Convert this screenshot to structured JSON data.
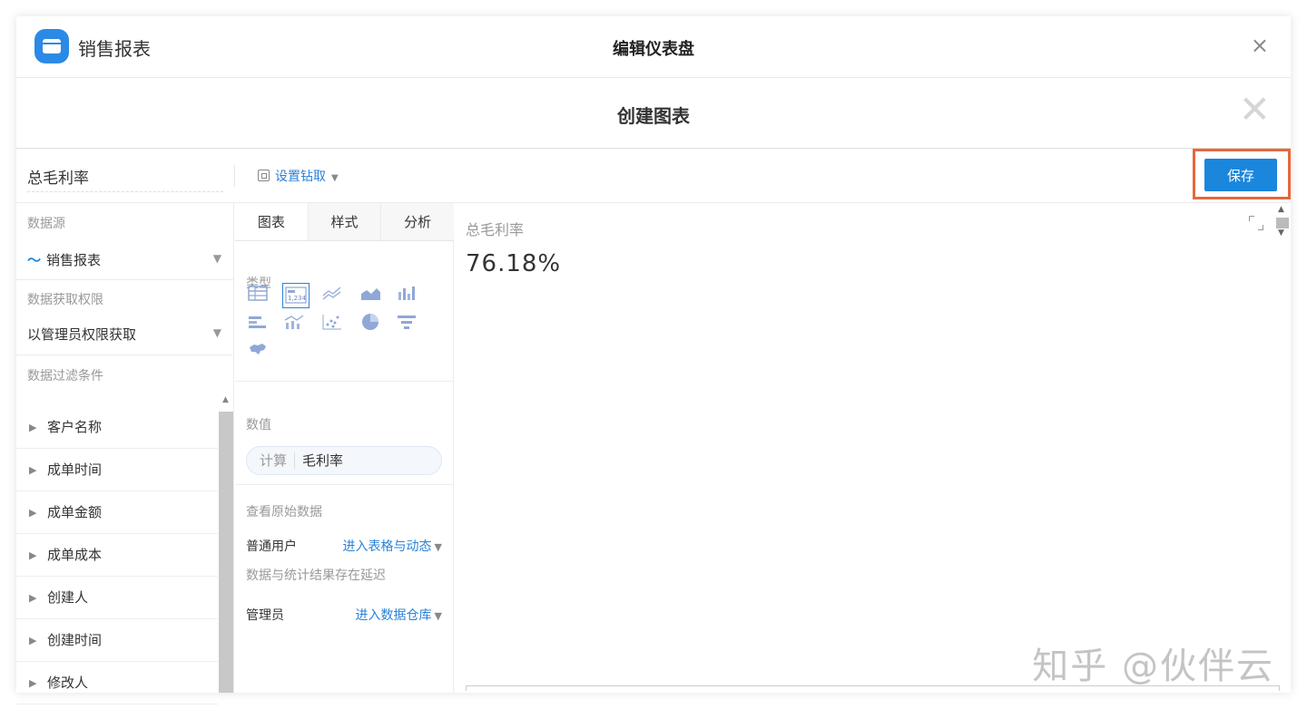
{
  "app": {
    "name": "销售报表",
    "title": "编辑仪表盘",
    "close": "×"
  },
  "dialog": {
    "title": "创建图表",
    "close": "✕"
  },
  "toolbar": {
    "chart_name": "总毛利率",
    "drill_label": "设置钻取",
    "drill_caret": "▼",
    "save_label": "保存"
  },
  "left": {
    "datasource_label": "数据源",
    "datasource_value": "销售报表",
    "datasource_icon": "trend-icon",
    "permission_label": "数据获取权限",
    "permission_value": "以管理员权限获取",
    "filter_label": "数据过滤条件",
    "caret": "▼",
    "filters": [
      "客户名称",
      "成单时间",
      "成单金额",
      "成单成本",
      "创建人",
      "创建时间",
      "修改人"
    ]
  },
  "tabs": [
    "图表",
    "样式",
    "分析"
  ],
  "chart_config": {
    "type_label": "类型",
    "types": [
      "table-icon",
      "kpi-number-icon",
      "line-chart-icon",
      "area-chart-icon",
      "bar-chart-icon",
      "horizontal-bar-icon",
      "combo-chart-icon",
      "scatter-chart-icon",
      "pie-chart-icon",
      "funnel-chart-icon",
      "map-icon"
    ],
    "selected_type": "kpi-number-icon",
    "value_label": "数值",
    "calc_tag": "计算",
    "calc_field": "毛利率",
    "raw_label": "查看原始数据",
    "normal_user_label": "普通用户",
    "normal_user_link": "进入表格与动态",
    "delay_note": "数据与统计结果存在延迟",
    "admin_label": "管理员",
    "admin_link": "进入数据仓库"
  },
  "preview": {
    "title": "总毛利率",
    "value": "76.18%"
  },
  "watermark": "知乎 @伙伴云",
  "colors": {
    "accent": "#1a86dc",
    "highlight_border": "#e5683b"
  }
}
